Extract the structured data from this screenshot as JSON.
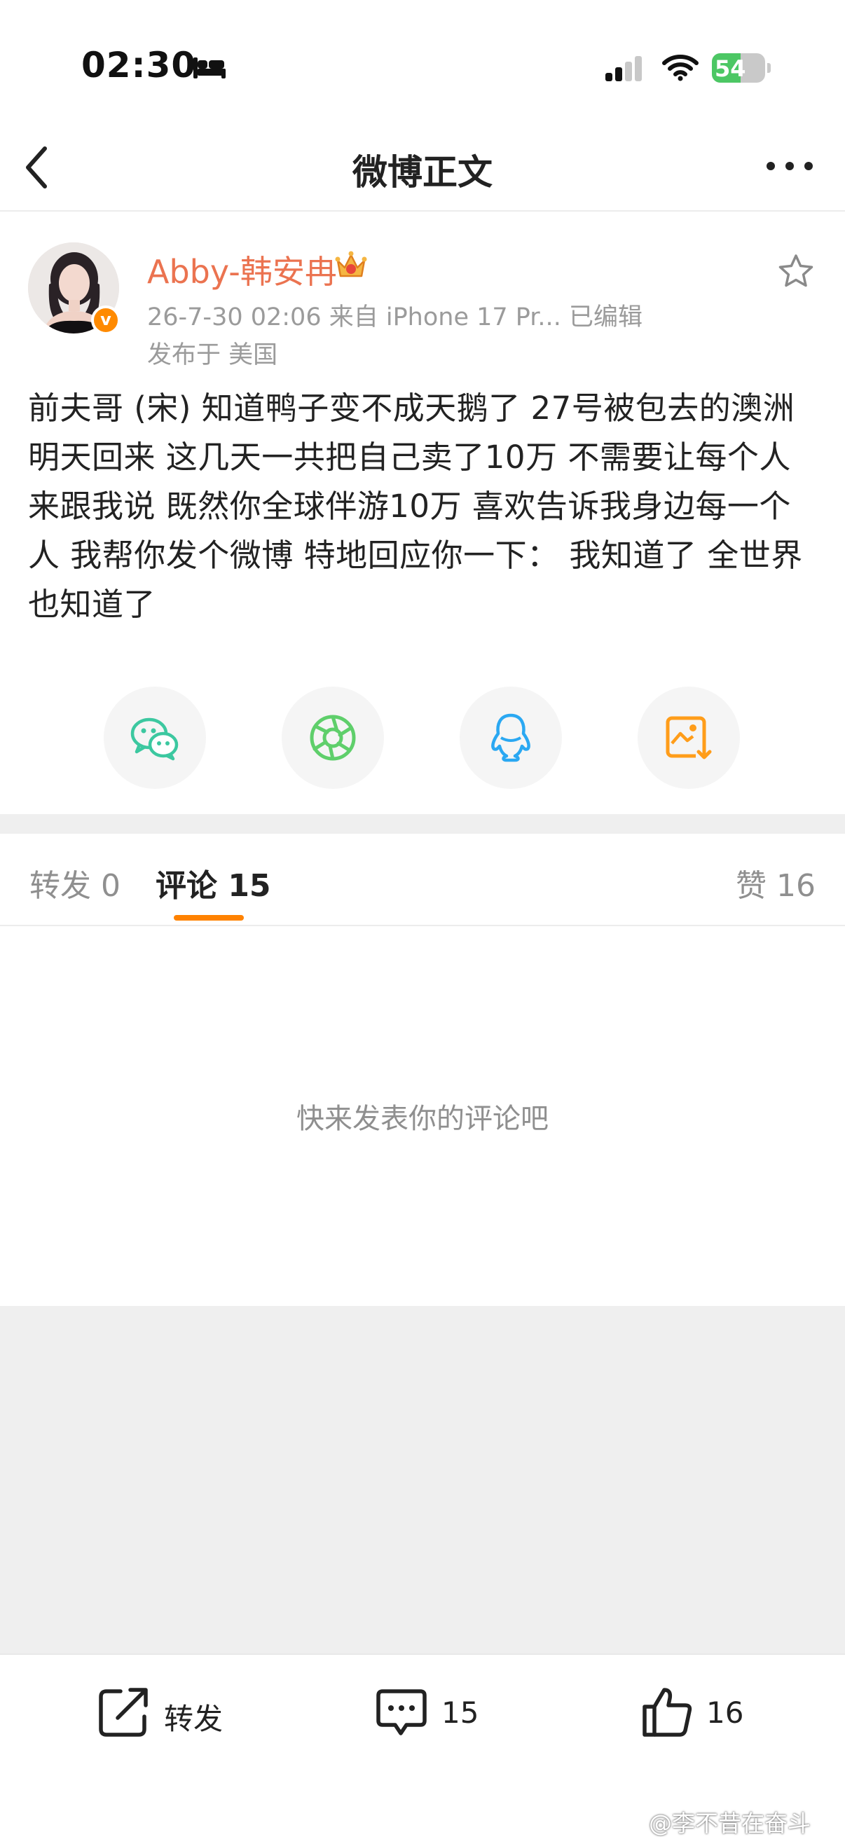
{
  "status_bar": {
    "time": "02:30",
    "battery_level": "54",
    "battery_fraction": 0.54,
    "icons": [
      "bed-icon",
      "cellular-signal-icon",
      "wifi-icon",
      "battery-icon"
    ]
  },
  "nav": {
    "title": "微博正文",
    "back_icon": "chevron-left-icon",
    "more_icon": "more-dots-icon"
  },
  "post": {
    "username": "Abby-韩安冉",
    "verified_badge": "v",
    "meta": "26-7-30 02:06  来自 iPhone 17 Pr...  已编辑",
    "location": "发布于 美国",
    "text": "前夫哥 (宋) 知道鸭子变不成天鹅了 27号被包去的澳洲 明天回来 这几天一共把自己卖了10万 不需要让每个人来跟我说 既然你全球伴游10万 喜欢告诉我身边每一个人 我帮你发个微博 特地回应你一下： 我知道了 全世界也知道了"
  },
  "share_targets": [
    "wechat-icon",
    "moments-icon",
    "qq-icon",
    "save-image-icon"
  ],
  "tabs": {
    "repost": "转发 0",
    "comments": "评论 15",
    "likes": "赞 16"
  },
  "comments": {
    "empty_hint": "快来发表你的评论吧"
  },
  "bottom_bar": {
    "repost_label": "转发",
    "comment_count": "15",
    "like_count": "16"
  },
  "watermark": "@李不昔在奋斗",
  "colors": {
    "username": "#eb7350",
    "accent": "#ff8200",
    "battery": "#4cc764",
    "wechat": "#3cc8a0",
    "moments": "#5fcf6b",
    "qq": "#2aa8f2",
    "save": "#ff9d1a"
  }
}
